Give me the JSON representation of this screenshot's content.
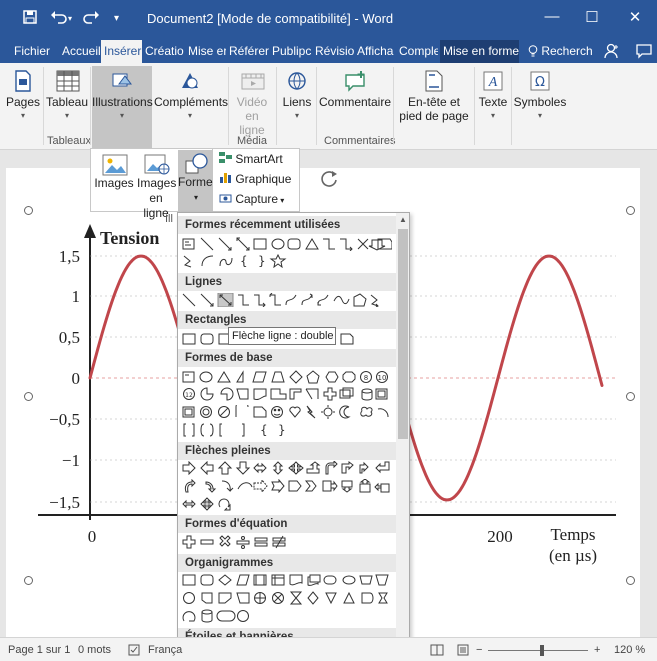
{
  "titlebar": {
    "title": "Document2 [Mode de compatibilité]  -  Word",
    "icons": {
      "save": "save-icon",
      "undo": "undo-icon",
      "redo": "redo-icon",
      "customize": "customize-qat-icon"
    },
    "minimize": "—",
    "maximize": "☐",
    "close": "✕",
    "accent": "#2b579a"
  },
  "tabs": [
    {
      "label": "Fichier"
    },
    {
      "label": "Accueil"
    },
    {
      "label": "Insérer"
    },
    {
      "label": "Créatio"
    },
    {
      "label": "Mise er"
    },
    {
      "label": "Référer"
    },
    {
      "label": "Publipc"
    },
    {
      "label": "Révisio"
    },
    {
      "label": "Afficha"
    },
    {
      "label": "Comple"
    },
    {
      "label": "Mise en forme"
    }
  ],
  "search": {
    "label": "Recherch",
    "icon": "lightbulb-icon"
  },
  "ribbon": {
    "buttons": [
      {
        "label": "Pages",
        "icon": "page-icon"
      },
      {
        "label": "Tableau",
        "icon": "table-icon"
      },
      {
        "label": "Illustrations",
        "icon": "illustrations-icon"
      },
      {
        "label": "Compléments",
        "icon": "addins-icon"
      },
      {
        "label": "Vidéo en ligne",
        "icon": "video-icon"
      },
      {
        "label": "Liens",
        "icon": "link-icon"
      },
      {
        "label": "Commentaire",
        "icon": "comment-icon"
      },
      {
        "label": "En-tête et pied de page",
        "icon": "header-footer-icon"
      },
      {
        "label": "Texte",
        "icon": "text-icon"
      },
      {
        "label": "Symboles",
        "icon": "omega-icon"
      }
    ],
    "groups": [
      "Tableaux",
      "Média",
      "Commentaires"
    ]
  },
  "illustrations_panel": {
    "images": "Images",
    "images_online": "Images en ligne",
    "forms": "Formes",
    "smartart": "SmartArt",
    "chart": "Graphique",
    "capture": "Capture",
    "group_label": "Ill"
  },
  "shapes_gallery": {
    "categories": [
      "Formes récemment utilisées",
      "Lignes",
      "Rectangles",
      "Formes de base",
      "Flèches pleines",
      "Formes d'équation",
      "Organigrammes",
      "Étoiles et bannières"
    ],
    "tooltip": "Flèche ligne : double"
  },
  "graph": {
    "y_title": "Tension",
    "y_ticks": [
      "1,5",
      "1",
      "0,5",
      "0",
      "−0,5",
      "−1",
      "−1,5"
    ],
    "x_ticks": [
      "0",
      "200"
    ],
    "x_title": "Temps",
    "x_unit": "(en µs)",
    "curve_color": "#c0464b"
  },
  "status": {
    "page": "Page 1 sur 1",
    "words": "0 mots",
    "language": "França",
    "zoom": "120 %",
    "zoom_minus": "−",
    "zoom_plus": "+"
  }
}
